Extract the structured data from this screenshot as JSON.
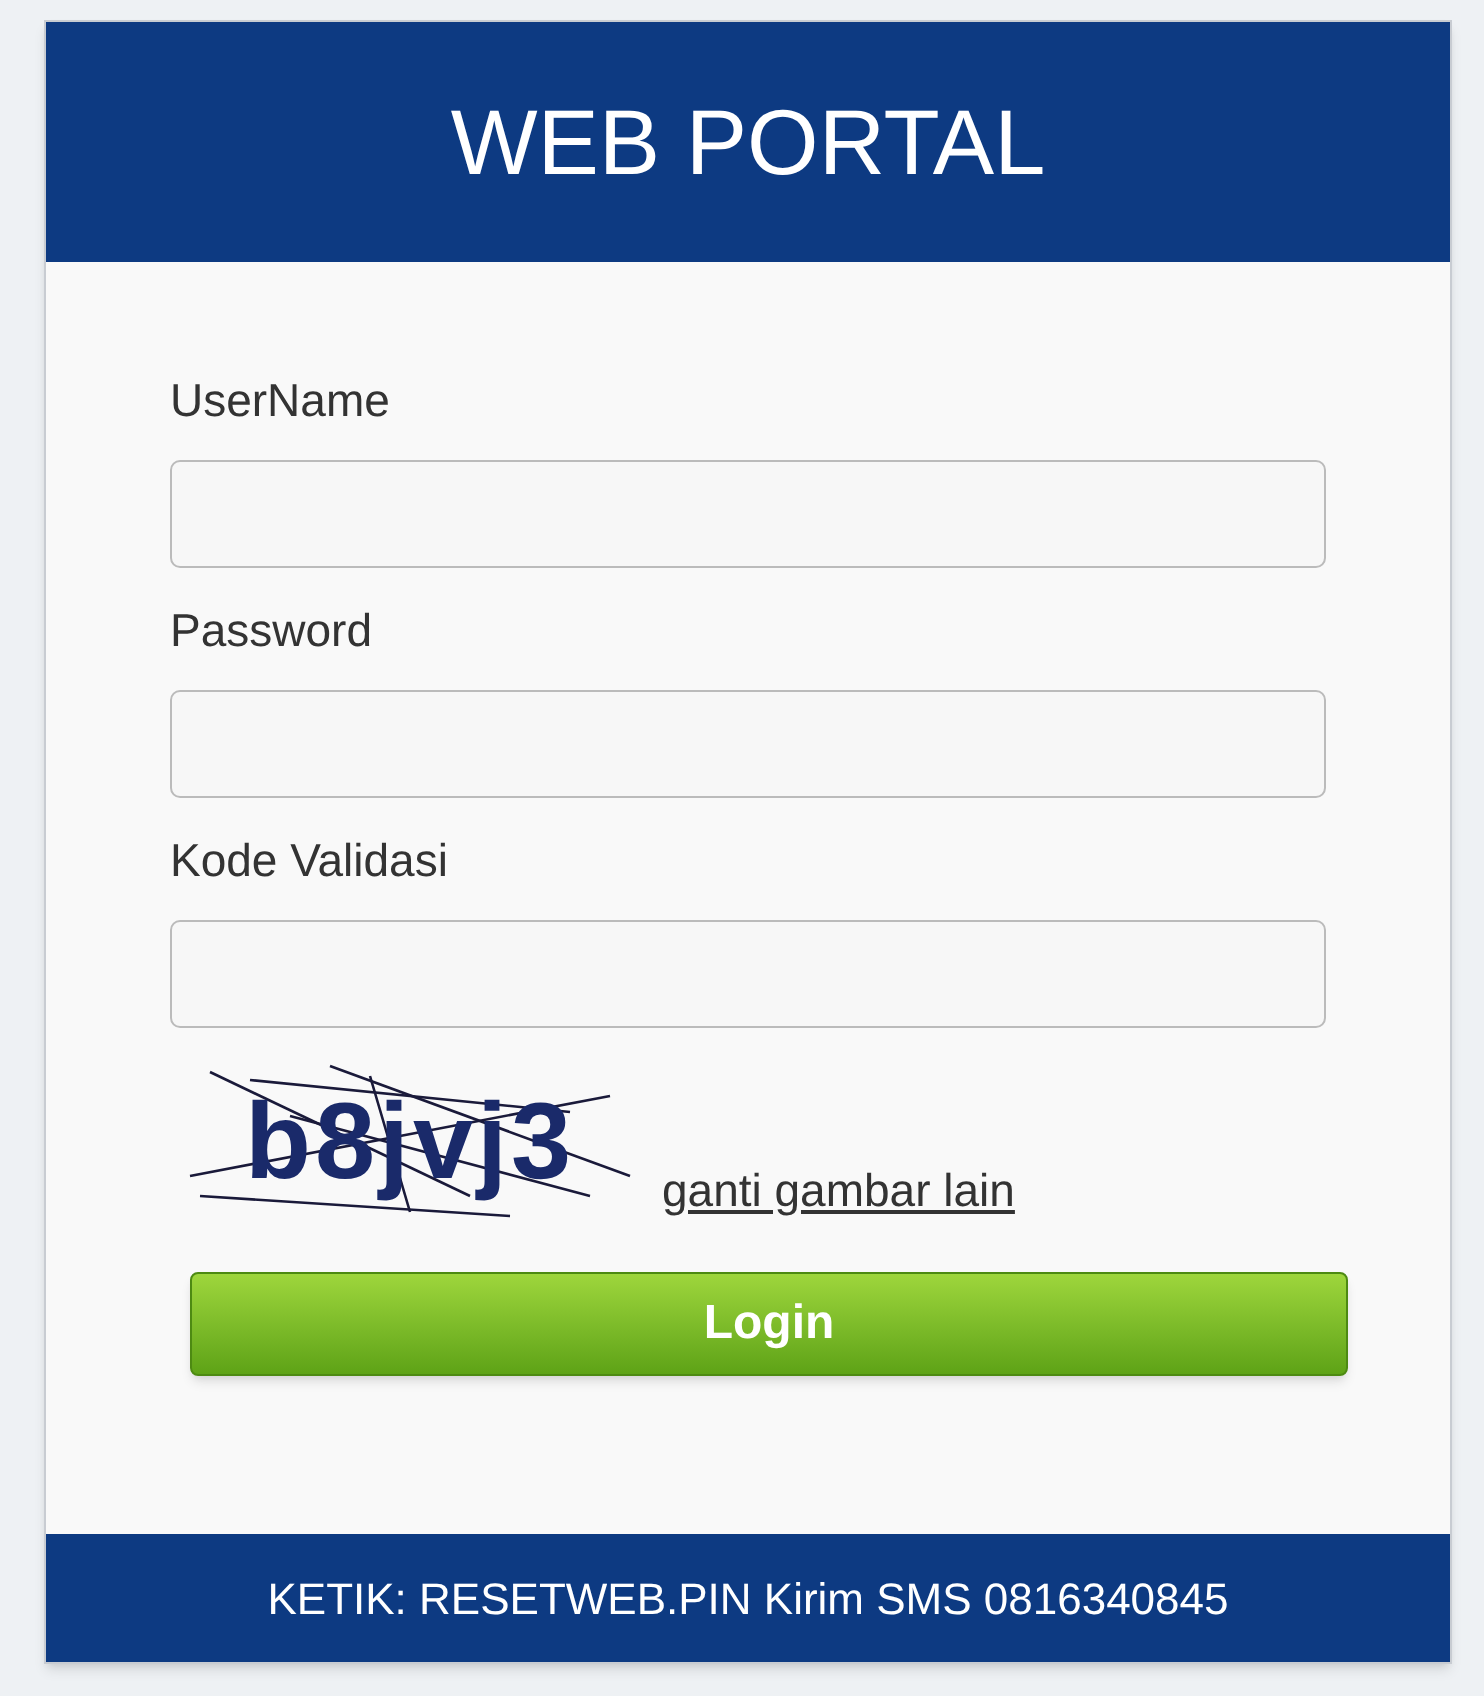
{
  "header": {
    "title": "WEB PORTAL"
  },
  "fields": [
    {
      "label": "UserName"
    },
    {
      "label": "Password"
    },
    {
      "label": "Kode Validasi"
    }
  ],
  "captcha": {
    "code": "b8jvj3",
    "refresh_link": "ganti gambar lain"
  },
  "login_button": "Login",
  "footer": "KETIK: RESETWEB.PIN Kirim SMS 0816340845"
}
